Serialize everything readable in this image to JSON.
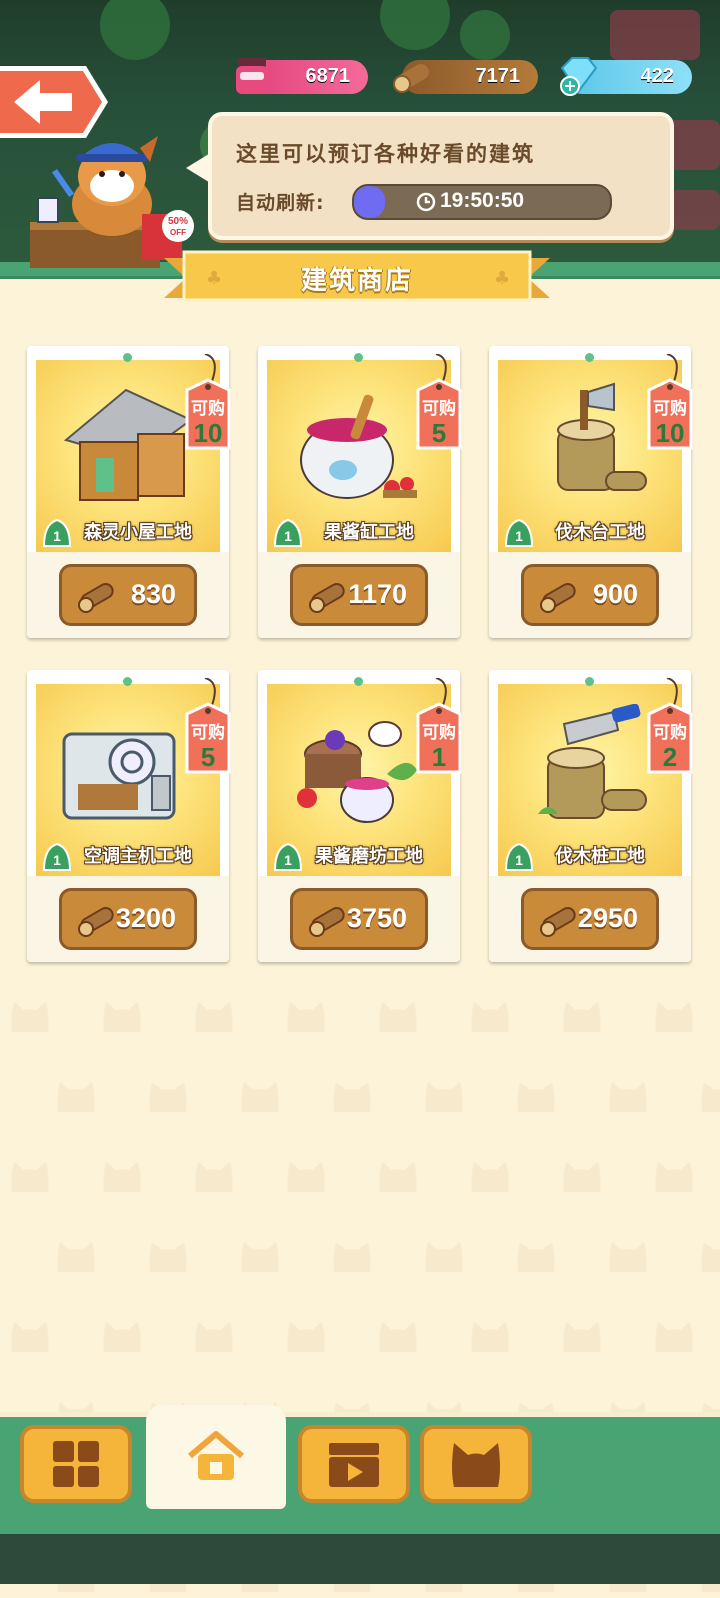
{
  "resources": {
    "jam": "6871",
    "wood": "7171",
    "gems": "422"
  },
  "mascot_sign": "50% OFF",
  "bubble": {
    "line1": "这里可以预订各种好看的建筑",
    "line2": "自动刷新:",
    "timer": "19:50:50",
    "timer_progress": 0.12
  },
  "shop_title": "建筑商店",
  "items": [
    {
      "name": "森灵小屋工地",
      "tag_label": "可购",
      "tag_count": "10",
      "level": "1",
      "price": "830"
    },
    {
      "name": "果酱缸工地",
      "tag_label": "可购",
      "tag_count": "5",
      "level": "1",
      "price": "1170"
    },
    {
      "name": "伐木台工地",
      "tag_label": "可购",
      "tag_count": "10",
      "level": "1",
      "price": "900"
    },
    {
      "name": "空调主机工地",
      "tag_label": "可购",
      "tag_count": "5",
      "level": "1",
      "price": "3200"
    },
    {
      "name": "果酱磨坊工地",
      "tag_label": "可购",
      "tag_count": "1",
      "level": "1",
      "price": "3750"
    },
    {
      "name": "伐木桩工地",
      "tag_label": "可购",
      "tag_count": "2",
      "level": "1",
      "price": "2950"
    }
  ],
  "nav": [
    {
      "icon": "grid-icon",
      "active": false
    },
    {
      "icon": "house-icon",
      "active": true
    },
    {
      "icon": "video-icon",
      "active": false
    },
    {
      "icon": "cat-icon",
      "active": false
    }
  ],
  "colors": {
    "accent_green": "#4aa373",
    "price_brown": "#c98a3a",
    "tag_red": "#f0705a",
    "timer_purple": "#6f6cf1"
  }
}
